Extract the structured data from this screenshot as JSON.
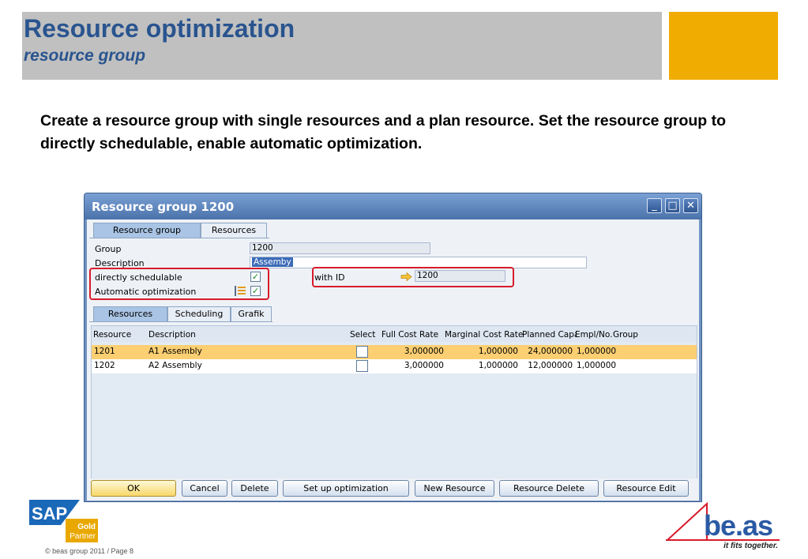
{
  "slide": {
    "title": "Resource optimization",
    "subtitle": "resource group",
    "intro": "Create a resource group with single resources and a plan resource. Set the resource group to directly schedulable, enable automatic optimization.",
    "footer": "© beas group 2011 / Page 8",
    "sap_logo": {
      "text": "SAP",
      "badge_line1": "Gold",
      "badge_line2": "Partner"
    },
    "beas_logo": {
      "text": "be.as",
      "tagline": "it fits together."
    },
    "colors": {
      "title": "#29548f",
      "header_grey": "#c0c0c0",
      "header_gold": "#f0ac00",
      "highlight": "#d81b2b"
    }
  },
  "window": {
    "title": "Resource group 1200",
    "controls": {
      "minimize": "_",
      "maximize": "□",
      "close": "✕"
    },
    "top_tabs": [
      "Resource group",
      "Resources"
    ],
    "form": {
      "group_label": "Group",
      "group_value": "1200",
      "description_label": "Description",
      "description_value": "Assemby",
      "directly_schedulable_label": "directly schedulable",
      "directly_schedulable_checked": true,
      "automatic_optimization_label": "Automatic optimization",
      "automatic_optimization_checked": true,
      "with_id_label": "with ID",
      "with_id_value": "1200"
    },
    "sub_tabs": [
      "Resources",
      "Scheduling",
      "Grafik"
    ],
    "grid": {
      "columns": [
        "Resource",
        "Description",
        "Select",
        "Full Cost Rate",
        "Marginal Cost Rate",
        "Planned Capa",
        "Empl/No.",
        "Group"
      ],
      "rows": [
        {
          "resource": "1201",
          "description": "A1 Assembly",
          "select": false,
          "full_cost_rate": "3,000000",
          "marginal_cost_rate": "1,000000",
          "planned_capa": "24,000000",
          "empl_no": "1,000000",
          "group": ""
        },
        {
          "resource": "1202",
          "description": "A2 Assembly",
          "select": false,
          "full_cost_rate": "3,000000",
          "marginal_cost_rate": "1,000000",
          "planned_capa": "12,000000",
          "empl_no": "1,000000",
          "group": ""
        }
      ]
    },
    "buttons": {
      "ok": "OK",
      "cancel": "Cancel",
      "delete": "Delete",
      "setup_optimization": "Set up optimization",
      "new_resource": "New Resource",
      "resource_delete": "Resource Delete",
      "resource_edit": "Resource Edit"
    }
  }
}
